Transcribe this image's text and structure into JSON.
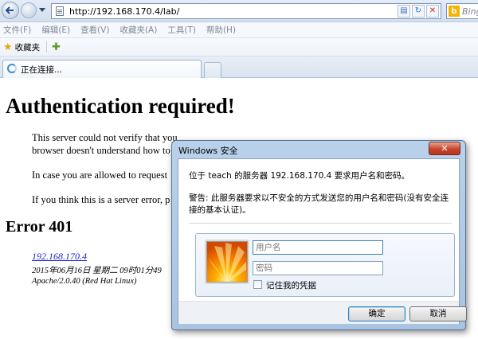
{
  "browser": {
    "url": "http://192.168.170.4/lab/",
    "search_placeholder": "Bing",
    "menu": [
      "文件(F)",
      "编辑(E)",
      "查看(V)",
      "收藏夹(A)",
      "工具(T)",
      "帮助(H)"
    ],
    "favorites_label": "收藏夹",
    "tab_label": "正在连接..."
  },
  "page": {
    "title": "Authentication required!",
    "para1_line1": "This server could not verify that you",
    "para1_line2": "browser doesn't understand how to",
    "para2": "In case you are allowed to request",
    "para3": "If you think this is a server error, p",
    "error_heading": "Error 401",
    "server_link": "192.168.170.4",
    "server_date": "2015年06月16日 星期二 09时01分49",
    "server_signature": "Apache/2.0.40 (Red Hat Linux)"
  },
  "dialog": {
    "title": "Windows 安全",
    "message": "位于 teach 的服务器 192.168.170.4 要求用户名和密码。",
    "warning": "警告: 此服务器要求以不安全的方式发送您的用户名和密码(没有安全连接的基本认证)。",
    "username_placeholder": "用户名",
    "password_placeholder": "密码",
    "remember_label": "记住我的凭据",
    "ok_label": "确定",
    "cancel_label": "取消"
  }
}
